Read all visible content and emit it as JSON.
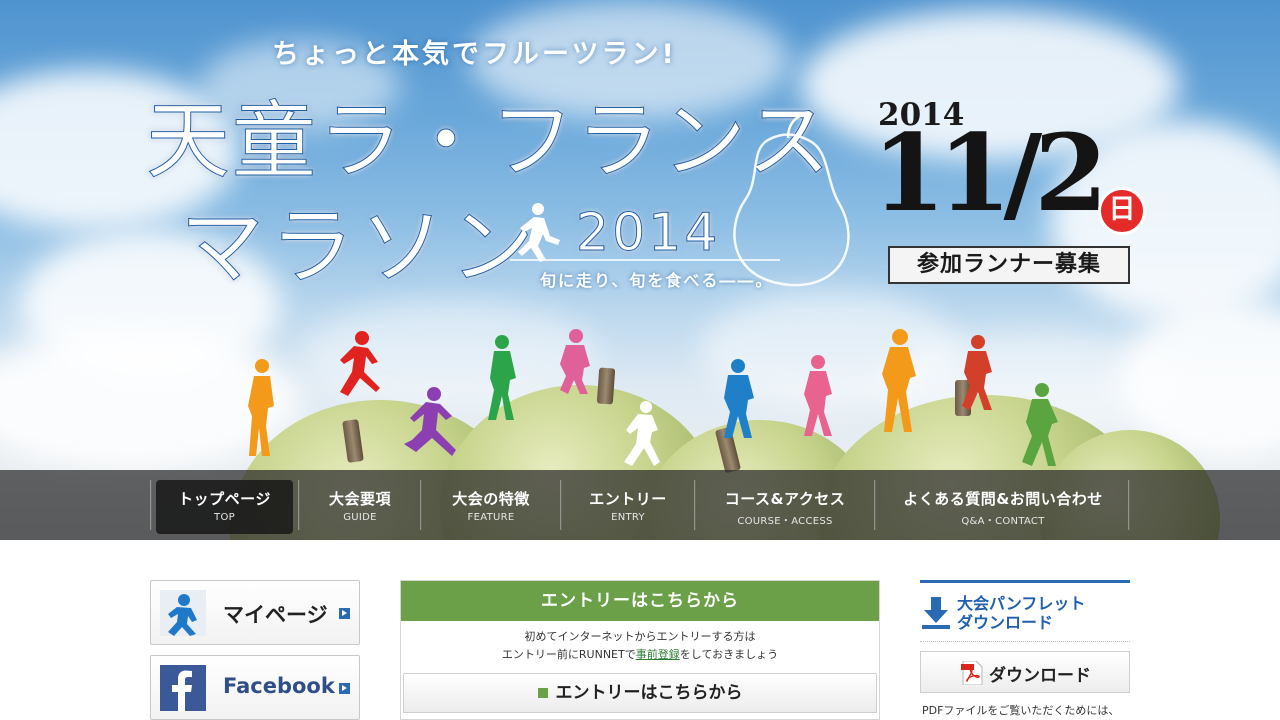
{
  "hero": {
    "tagline": "ちょっと本気でフルーツラン!",
    "title_line1": "天童ラ・フランス",
    "title_line2": "マラソン",
    "title_year": "2014",
    "subtitle": "旬に走り、旬を食べる――。",
    "date_year": "2014",
    "date_main": "11/2",
    "date_day": "日",
    "recruit": "参加ランナー募集"
  },
  "nav": {
    "items": [
      {
        "jp": "トップページ",
        "en": "TOP"
      },
      {
        "jp": "大会要項",
        "en": "GUIDE"
      },
      {
        "jp": "大会の特徴",
        "en": "FEATURE"
      },
      {
        "jp": "エントリー",
        "en": "ENTRY"
      },
      {
        "jp": "コース&アクセス",
        "en": "COURSE・ACCESS"
      },
      {
        "jp": "よくある質問&お問い合わせ",
        "en": "Q&A・CONTACT"
      }
    ]
  },
  "sidebar": {
    "mypage_label": "マイページ",
    "facebook_label": "Facebook"
  },
  "entry": {
    "heading": "エントリーはこちらから",
    "line1": "初めてインターネットからエントリーする方は",
    "line2_pre": "エントリー前にRUNNETで",
    "line2_link": "事前登録",
    "line2_post": "をしておきましょう",
    "button": "エントリーはこちらから"
  },
  "pamphlet": {
    "title_line1": "大会パンフレット",
    "title_line2": "ダウンロード",
    "download_label": "ダウンロード",
    "note": "PDFファイルをご覧いただくためには、"
  },
  "colors": {
    "accent_blue": "#2a6ab5",
    "entry_green": "#6ca048",
    "day_red": "#e52a2a"
  }
}
